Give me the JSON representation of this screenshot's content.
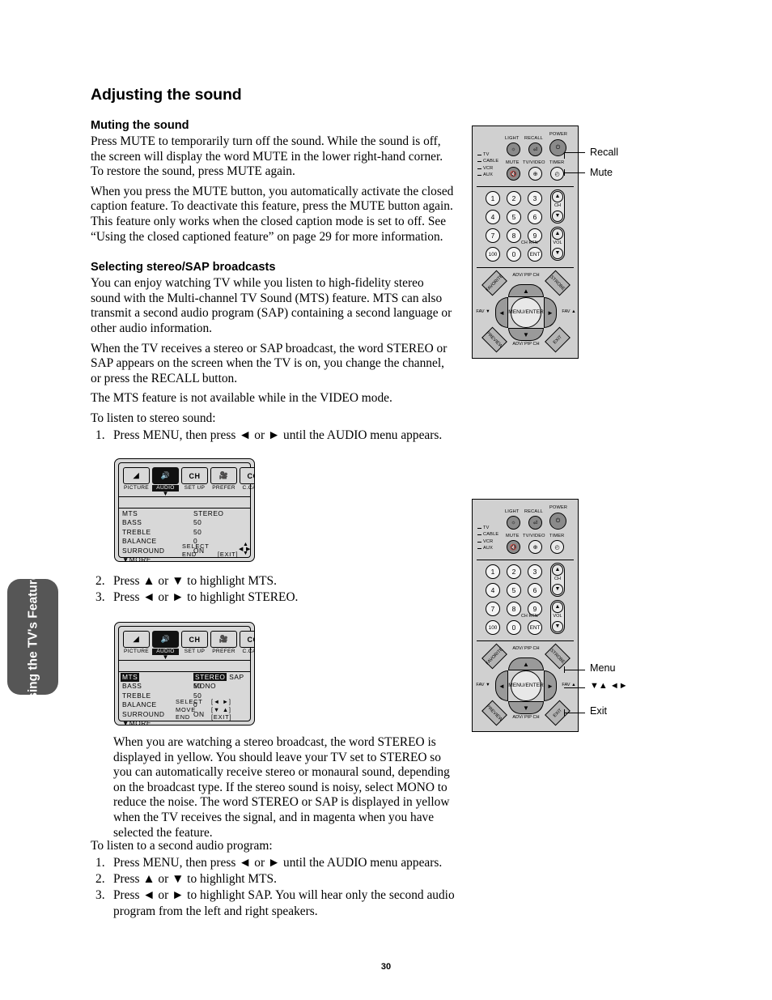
{
  "document": {
    "page_number": "30",
    "side_tab": "Using the TV's Features"
  },
  "content": {
    "title": "Adjusting the sound",
    "section1": {
      "heading": "Muting the sound",
      "paragraph1": "Press MUTE to temporarily turn off the sound. While the sound is off, the screen will display the word MUTE in the lower right-hand corner. To restore the sound, press MUTE again.",
      "paragraph2": "When you press the MUTE button, you automatically activate the closed caption feature. To deactivate this feature, press the MUTE button again. This feature only works when the closed caption mode is set to off. See “Using the closed captioned feature” on page 29 for more information."
    },
    "section2": {
      "heading": "Selecting stereo/SAP broadcasts",
      "paragraph1": "You can enjoy watching TV while you listen to high-fidelity stereo sound with the Multi-channel TV Sound (MTS) feature. MTS can also transmit a second audio program (SAP) containing a second language or other audio information.",
      "paragraph2": "When the TV receives a stereo or SAP broadcast, the word STEREO or SAP appears on the screen when the TV is on, you change the channel, or press the RECALL button.",
      "paragraph3": "The MTS feature is not available while in the VIDEO mode.",
      "lead1": "To listen to stereo sound:",
      "steps1": [
        {
          "num": "1.",
          "text": "Press MENU, then press ◄ or ► until the AUDIO menu appears."
        },
        {
          "num": "2.",
          "text": "Press ▲ or ▼ to highlight MTS."
        },
        {
          "num": "3.",
          "text": "Press ◄ or ► to highlight STEREO."
        }
      ],
      "note": "When you are watching a stereo broadcast, the word STEREO is displayed in yellow. You should leave your TV set to STEREO so you can automatically receive stereo or monaural sound, depending on the broadcast type. If the stereo sound is noisy, select MONO to reduce the noise. The word STEREO or SAP is displayed in yellow when the TV receives the signal, and in magenta when you have selected the feature.",
      "lead2": "To listen to a second audio program:",
      "steps2": [
        {
          "num": "1.",
          "text": "Press MENU, then press ◄ or ► until the AUDIO menu appears."
        },
        {
          "num": "2.",
          "text": "Press ▲ or ▼ to highlight MTS."
        },
        {
          "num": "3.",
          "text": "Press ◄ or ► to highlight SAP. You will hear only the second audio program from the left and right speakers."
        }
      ]
    }
  },
  "osd_menu_1": {
    "tabs": [
      {
        "glyph": "◢",
        "label": "PICTURE",
        "selected": false
      },
      {
        "glyph": "🔊",
        "label": "AUDIO",
        "selected": true
      },
      {
        "glyph": "CH",
        "label": "SET UP",
        "selected": false
      },
      {
        "glyph": "🎥",
        "label": "PREFER",
        "selected": false
      },
      {
        "glyph": "CC",
        "label": "C.CAPT",
        "selected": false
      }
    ],
    "rows": [
      {
        "key": "MTS",
        "value": "STEREO",
        "highlight": false
      },
      {
        "key": "BASS",
        "value": "50",
        "highlight": false
      },
      {
        "key": "TREBLE",
        "value": "50",
        "highlight": false
      },
      {
        "key": "BALANCE",
        "value": "0",
        "highlight": false
      },
      {
        "key": "SURROUND",
        "value": "ON",
        "highlight": false
      },
      {
        "key": "▼MORE",
        "value": "",
        "highlight": false
      }
    ],
    "footer": [
      {
        "key": "SELECT",
        "value": ""
      },
      {
        "key": "END",
        "value": "[EXIT]"
      }
    ]
  },
  "osd_menu_2": {
    "tabs": [
      {
        "glyph": "◢",
        "label": "PICTURE",
        "selected": false
      },
      {
        "glyph": "🔊",
        "label": "AUDIO",
        "selected": true
      },
      {
        "glyph": "CH",
        "label": "SET UP",
        "selected": false
      },
      {
        "glyph": "🎥",
        "label": "PREFER",
        "selected": false
      },
      {
        "glyph": "CC",
        "label": "C.CAPT",
        "selected": false
      }
    ],
    "rows": [
      {
        "key": "MTS",
        "value": "STEREO SAP MONO",
        "option_selected": "STEREO",
        "options": [
          "STEREO",
          "SAP",
          "MONO"
        ],
        "highlight": true
      },
      {
        "key": "BASS",
        "value": "50",
        "highlight": false
      },
      {
        "key": "TREBLE",
        "value": "50",
        "highlight": false
      },
      {
        "key": "BALANCE",
        "value": "0",
        "highlight": false
      },
      {
        "key": "SURROUND",
        "value": "ON",
        "highlight": false
      },
      {
        "key": "▼MORE",
        "value": "",
        "highlight": false
      }
    ],
    "footer": [
      {
        "key": "SELECT",
        "value": "[◄ ►]"
      },
      {
        "key": "MOVE",
        "value": "[▼ ▲]"
      },
      {
        "key": "END",
        "value": "[EXIT]"
      }
    ]
  },
  "remote": {
    "top_labels": {
      "light": "LIGHT",
      "recall": "RECALL",
      "power": "POWER",
      "mute": "MUTE",
      "tv_video": "TV/VIDEO",
      "timer": "TIMER"
    },
    "modes": [
      "TV",
      "CABLE",
      "VCR",
      "AUX"
    ],
    "keypad": [
      "1",
      "2",
      "3",
      "4",
      "5",
      "6",
      "7",
      "8",
      "9",
      "100",
      "0",
      "ENT"
    ],
    "ch_rtn": "CH RTN",
    "rocker_ch": "CH",
    "rocker_vol": "VOL",
    "nav": {
      "top": "ADV/\nPIP CH",
      "bottom": "ADV/\nPIP CH",
      "left": "FAV ▼",
      "right": "FAV ▲",
      "center": "MENU/\nENTER",
      "corner_tl": "FAVORITE",
      "corner_tr": "STROBE",
      "corner_bl": "PREVIEW",
      "corner_br": "EXIT"
    }
  },
  "callouts": {
    "remote1": [
      {
        "label": "Recall"
      },
      {
        "label": "Mute"
      }
    ],
    "remote2": [
      {
        "label": "Menu"
      },
      {
        "label": "▼▲ ◄►"
      },
      {
        "label": "Exit"
      }
    ]
  }
}
